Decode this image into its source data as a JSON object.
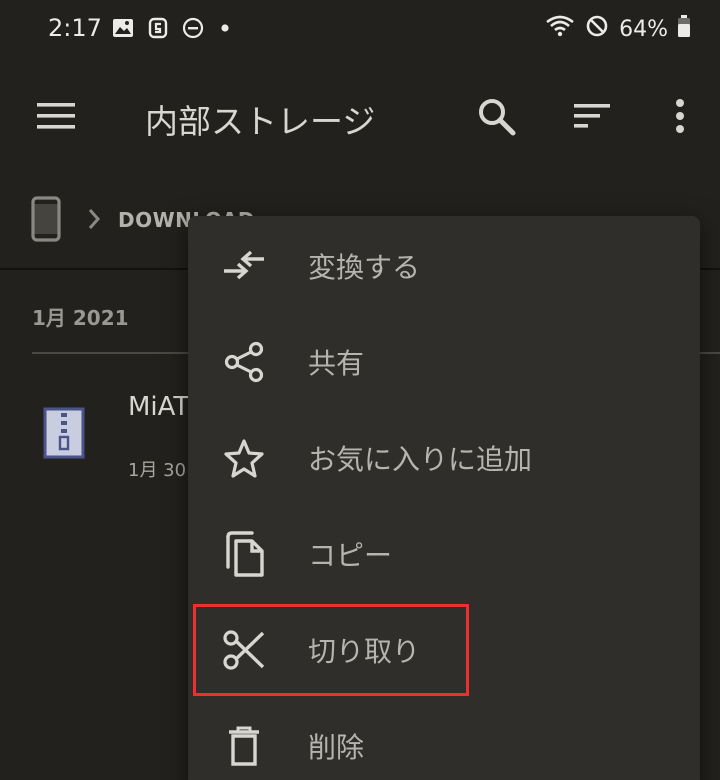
{
  "status_bar": {
    "time": "2:17",
    "battery": "64%",
    "left_icons": [
      "gallery-icon",
      "app-icon",
      "dnd-icon",
      "dot-icon"
    ],
    "right_icons": [
      "wifi-icon",
      "blocked-icon",
      "battery-icon"
    ]
  },
  "app_bar": {
    "title": "内部ストレージ",
    "icons": [
      "menu-icon",
      "search-icon",
      "sort-icon",
      "more-vert-icon"
    ]
  },
  "breadcrumb": {
    "device_icon": "phone-icon",
    "folder": "DOWNLOAD"
  },
  "file_list": {
    "section_header": "1月 2021",
    "items": [
      {
        "name": "MiAT",
        "date": "1月 30",
        "icon": "zip-file-icon"
      }
    ]
  },
  "context_menu": {
    "items": [
      {
        "label": "変換する",
        "icon": "convert-icon"
      },
      {
        "label": "共有",
        "icon": "share-icon"
      },
      {
        "label": "お気に入りに追加",
        "icon": "star-icon"
      },
      {
        "label": "コピー",
        "icon": "copy-icon"
      },
      {
        "label": "切り取り",
        "icon": "cut-icon",
        "highlighted": true
      },
      {
        "label": "削除",
        "icon": "delete-icon"
      }
    ]
  },
  "colors": {
    "background": "#22211d",
    "menu_background": "#2f2e2a",
    "highlight": "#ef2f2f",
    "menu_text": "#b6b4ae"
  }
}
